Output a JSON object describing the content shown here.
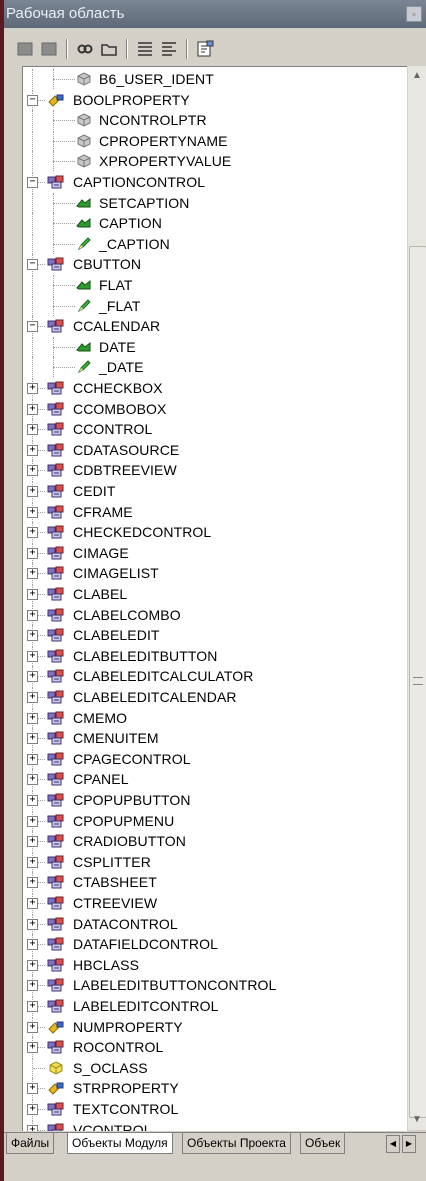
{
  "window": {
    "title": "Рабочая область"
  },
  "tree": [
    {
      "label": "B6_USER_IDENT",
      "level": 1,
      "icon": "gray-cube-icon",
      "exp": ""
    },
    {
      "label": "BOOLPROPERTY",
      "level": 0,
      "icon": "yellow-property-icon",
      "exp": "-"
    },
    {
      "label": "NCONTROLPTR",
      "level": 1,
      "icon": "gray-cube-icon",
      "exp": ""
    },
    {
      "label": "CPROPERTYNAME",
      "level": 1,
      "icon": "gray-cube-icon",
      "exp": ""
    },
    {
      "label": "XPROPERTYVALUE",
      "level": 1,
      "icon": "gray-cube-icon",
      "exp": ""
    },
    {
      "label": "CAPTIONCONTROL",
      "level": 0,
      "icon": "class-icon",
      "exp": "-"
    },
    {
      "label": "SETCAPTION",
      "level": 1,
      "icon": "green-method-icon",
      "exp": ""
    },
    {
      "label": "CAPTION",
      "level": 1,
      "icon": "green-method-icon",
      "exp": ""
    },
    {
      "label": "_CAPTION",
      "level": 1,
      "icon": "green-pencil-icon",
      "exp": ""
    },
    {
      "label": "CBUTTON",
      "level": 0,
      "icon": "class-icon",
      "exp": "-"
    },
    {
      "label": "FLAT",
      "level": 1,
      "icon": "green-method-icon",
      "exp": ""
    },
    {
      "label": "_FLAT",
      "level": 1,
      "icon": "green-pencil-icon",
      "exp": ""
    },
    {
      "label": "CCALENDAR",
      "level": 0,
      "icon": "class-icon",
      "exp": "-"
    },
    {
      "label": "DATE",
      "level": 1,
      "icon": "green-method-icon",
      "exp": ""
    },
    {
      "label": "_DATE",
      "level": 1,
      "icon": "green-pencil-icon",
      "exp": ""
    },
    {
      "label": "CCHECKBOX",
      "level": 0,
      "icon": "class-icon",
      "exp": "+"
    },
    {
      "label": "CCOMBOBOX",
      "level": 0,
      "icon": "class-icon",
      "exp": "+"
    },
    {
      "label": "CCONTROL",
      "level": 0,
      "icon": "class-icon",
      "exp": "+"
    },
    {
      "label": "CDATASOURCE",
      "level": 0,
      "icon": "class-icon",
      "exp": "+"
    },
    {
      "label": "CDBTREEVIEW",
      "level": 0,
      "icon": "class-icon",
      "exp": "+"
    },
    {
      "label": "CEDIT",
      "level": 0,
      "icon": "class-icon",
      "exp": "+"
    },
    {
      "label": "CFRAME",
      "level": 0,
      "icon": "class-icon",
      "exp": "+"
    },
    {
      "label": "CHECKEDCONTROL",
      "level": 0,
      "icon": "class-icon",
      "exp": "+"
    },
    {
      "label": "CIMAGE",
      "level": 0,
      "icon": "class-icon",
      "exp": "+"
    },
    {
      "label": "CIMAGELIST",
      "level": 0,
      "icon": "class-icon",
      "exp": "+"
    },
    {
      "label": "CLABEL",
      "level": 0,
      "icon": "class-icon",
      "exp": "+"
    },
    {
      "label": "CLABELCOMBO",
      "level": 0,
      "icon": "class-icon",
      "exp": "+"
    },
    {
      "label": "CLABELEDIT",
      "level": 0,
      "icon": "class-icon",
      "exp": "+"
    },
    {
      "label": "CLABELEDITBUTTON",
      "level": 0,
      "icon": "class-icon",
      "exp": "+"
    },
    {
      "label": "CLABELEDITCALCULATOR",
      "level": 0,
      "icon": "class-icon",
      "exp": "+"
    },
    {
      "label": "CLABELEDITCALENDAR",
      "level": 0,
      "icon": "class-icon",
      "exp": "+"
    },
    {
      "label": "CMEMO",
      "level": 0,
      "icon": "class-icon",
      "exp": "+"
    },
    {
      "label": "CMENUITEM",
      "level": 0,
      "icon": "class-icon",
      "exp": "+"
    },
    {
      "label": "CPAGECONTROL",
      "level": 0,
      "icon": "class-icon",
      "exp": "+"
    },
    {
      "label": "CPANEL",
      "level": 0,
      "icon": "class-icon",
      "exp": "+"
    },
    {
      "label": "CPOPUPBUTTON",
      "level": 0,
      "icon": "class-icon",
      "exp": "+"
    },
    {
      "label": "CPOPUPMENU",
      "level": 0,
      "icon": "class-icon",
      "exp": "+"
    },
    {
      "label": "CRADIOBUTTON",
      "level": 0,
      "icon": "class-icon",
      "exp": "+"
    },
    {
      "label": "CSPLITTER",
      "level": 0,
      "icon": "class-icon",
      "exp": "+"
    },
    {
      "label": "CTABSHEET",
      "level": 0,
      "icon": "class-icon",
      "exp": "+"
    },
    {
      "label": "CTREEVIEW",
      "level": 0,
      "icon": "class-icon",
      "exp": "+"
    },
    {
      "label": "DATACONTROL",
      "level": 0,
      "icon": "class-icon",
      "exp": "+"
    },
    {
      "label": "DATAFIELDCONTROL",
      "level": 0,
      "icon": "class-icon",
      "exp": "+"
    },
    {
      "label": "HBCLASS",
      "level": 0,
      "icon": "class-icon",
      "exp": "+"
    },
    {
      "label": "LABELEDITBUTTONCONTROL",
      "level": 0,
      "icon": "class-icon",
      "exp": "+"
    },
    {
      "label": "LABELEDITCONTROL",
      "level": 0,
      "icon": "class-icon",
      "exp": "+"
    },
    {
      "label": "NUMPROPERTY",
      "level": 0,
      "icon": "yellow-property-icon",
      "exp": "+"
    },
    {
      "label": "ROCONTROL",
      "level": 0,
      "icon": "class-icon",
      "exp": "+"
    },
    {
      "label": "S_OCLASS",
      "level": 0,
      "icon": "yellow-cube-icon",
      "exp": ""
    },
    {
      "label": "STRPROPERTY",
      "level": 0,
      "icon": "yellow-property-icon",
      "exp": "+"
    },
    {
      "label": "TEXTCONTROL",
      "level": 0,
      "icon": "class-icon",
      "exp": "+"
    },
    {
      "label": "VCONTROL",
      "level": 0,
      "icon": "class-icon",
      "exp": "+"
    }
  ],
  "tabs": [
    {
      "label": "Файлы",
      "active": false
    },
    {
      "label": "Объекты Модуля",
      "active": true
    },
    {
      "label": "Объекты Проекта",
      "active": false
    },
    {
      "label": "Объек",
      "active": false
    }
  ],
  "colors": {
    "title_bg": "#66727f",
    "panel_bg": "#ffffff",
    "chrome": "#d4d0c8"
  }
}
